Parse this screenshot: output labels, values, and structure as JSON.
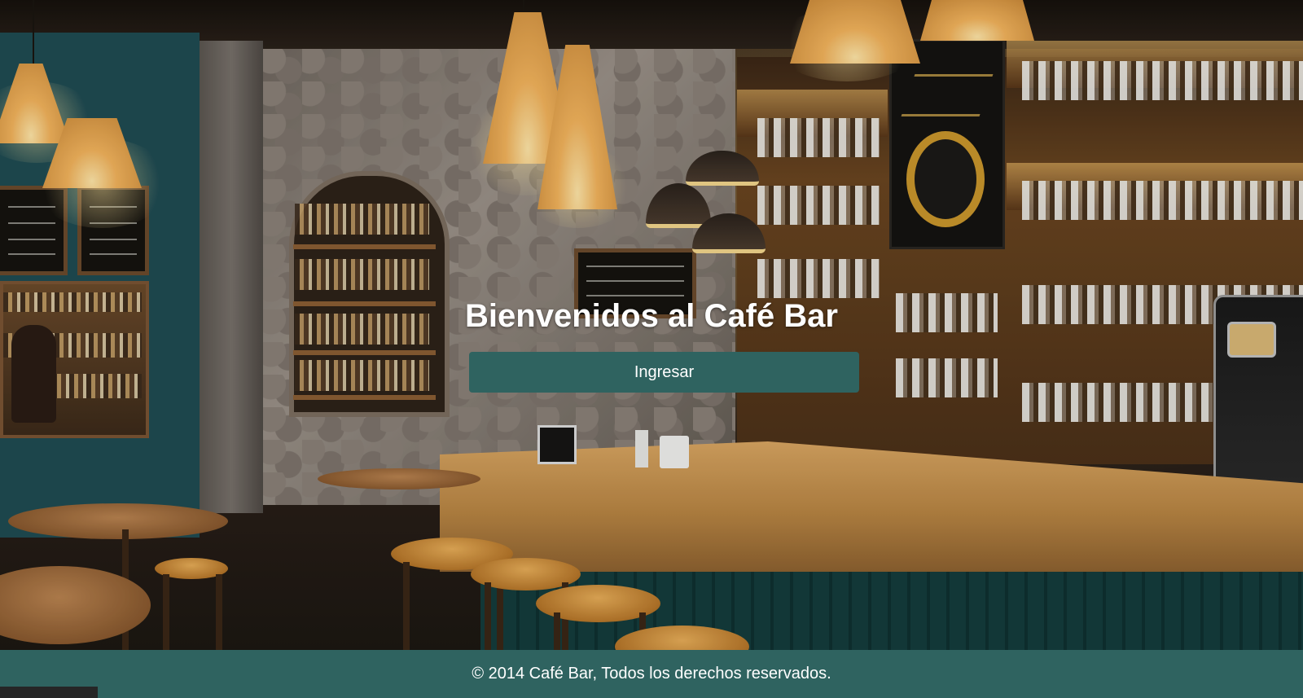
{
  "hero": {
    "title": "Bienvenidos al Café Bar",
    "enter_button_label": "Ingresar"
  },
  "footer": {
    "text": "© 2014 Café Bar, Todos los derechos reservados."
  },
  "colors": {
    "accent": "#2f6360",
    "text": "#ffffff"
  },
  "background": {
    "description_icon": "cafe-bar-interior-photo"
  }
}
